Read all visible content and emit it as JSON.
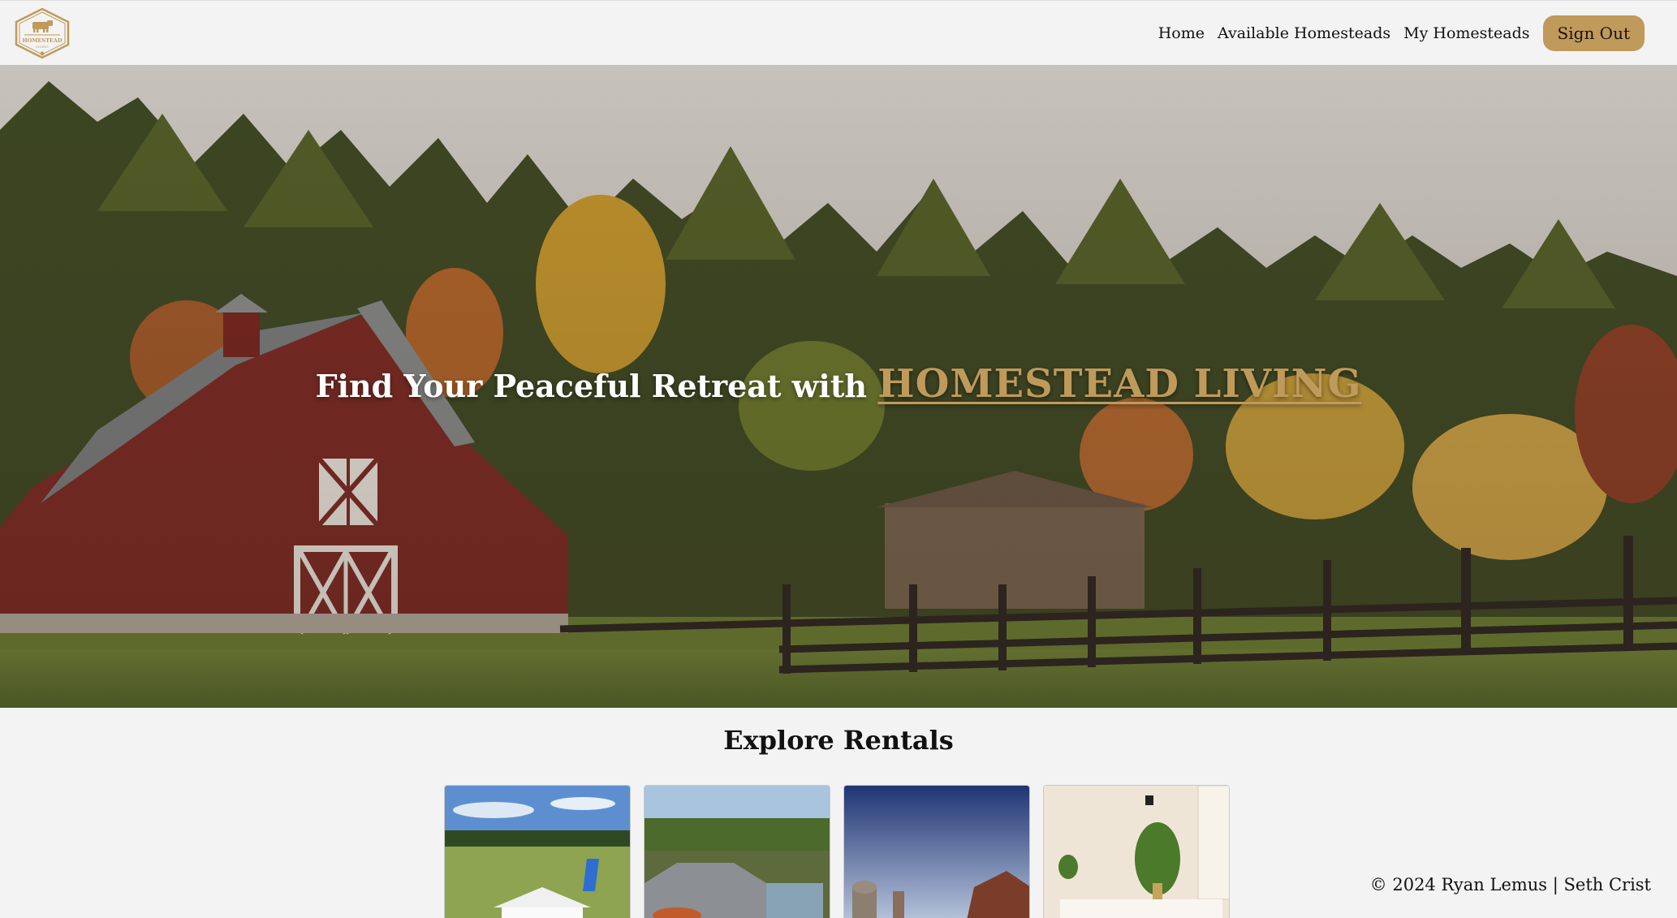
{
  "logo": {
    "text_top": "HOMESTEAD",
    "text_bottom": "LIVING",
    "icon": "cow-icon"
  },
  "nav": {
    "home": "Home",
    "available": "Available Homesteads",
    "mine": "My Homesteads",
    "signout": "Sign Out"
  },
  "hero": {
    "title_prefix": "Find Your Peaceful Retreat with",
    "title_brand": "HOMESTEAD LIVING"
  },
  "explore": {
    "title": "Explore Rentals"
  },
  "footer": {
    "text": "© 2024 Ryan Lemus | Seth Crist"
  },
  "colors": {
    "accent": "#c09a5b",
    "background": "#f3f3f3",
    "barn": "#7e2a24"
  }
}
